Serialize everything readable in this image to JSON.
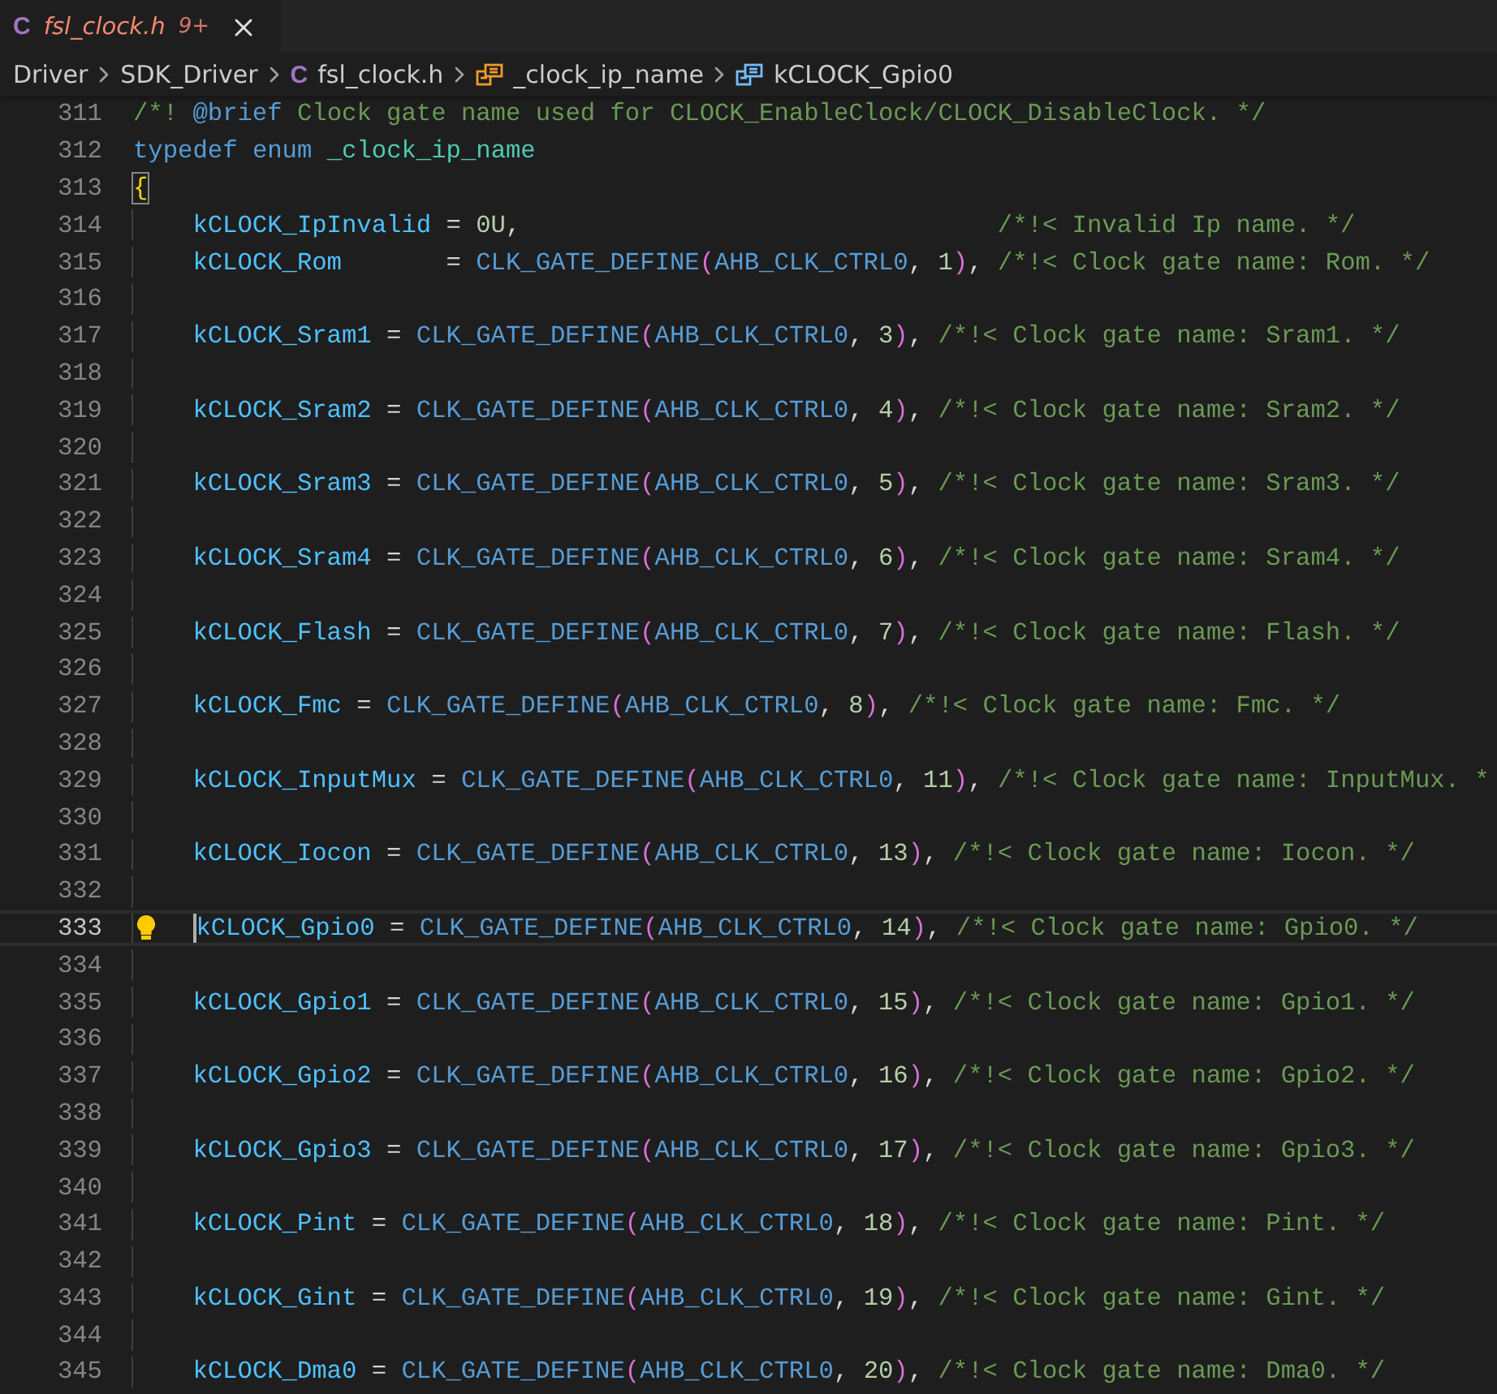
{
  "tab": {
    "icon": "C",
    "label": "fsl_clock.h",
    "badge": "9+"
  },
  "breadcrumb": [
    {
      "kind": "folder",
      "label": "Driver"
    },
    {
      "kind": "folder",
      "label": "SDK_Driver"
    },
    {
      "kind": "file",
      "icon": "C",
      "label": "fsl_clock.h"
    },
    {
      "kind": "enum",
      "label": "_clock_ip_name"
    },
    {
      "kind": "enum-member",
      "label": "kCLOCK_Gpio0"
    }
  ],
  "lines": [
    {
      "number": "311",
      "indented": false,
      "current": false,
      "tokens": [
        {
          "kind": "comment",
          "text": "/*! "
        },
        {
          "kind": "doctag",
          "text": "@brief"
        },
        {
          "kind": "comment",
          "text": " Clock gate name used for CLOCK_EnableClock/CLOCK_DisableClock. */"
        }
      ]
    },
    {
      "number": "312",
      "indented": false,
      "current": false,
      "tokens": [
        {
          "kind": "keyword",
          "text": "typedef"
        },
        {
          "kind": "keyword",
          "text": " enum"
        },
        {
          "kind": "type",
          "text": " _clock_ip_name"
        }
      ]
    },
    {
      "number": "313",
      "indented": false,
      "current": false,
      "tokens": [
        {
          "kind": "bracket",
          "text": "{"
        }
      ]
    },
    {
      "number": "314",
      "indented": true,
      "current": false,
      "tokens": [
        {
          "kind": "member",
          "text": "kCLOCK_IpInvalid"
        },
        {
          "kind": "punct",
          "text": " = "
        },
        {
          "kind": "number",
          "text": "0U"
        },
        {
          "kind": "punct",
          "text": ",                                "
        },
        {
          "kind": "comment",
          "text": "/*!< Invalid Ip name. */"
        }
      ]
    },
    {
      "number": "315",
      "indented": true,
      "current": false,
      "tokens": [
        {
          "kind": "member",
          "text": "kCLOCK_Rom"
        },
        {
          "kind": "punct",
          "text": "       = "
        },
        {
          "kind": "macro",
          "text": "CLK_GATE_DEFINE"
        },
        {
          "kind": "paren",
          "text": "("
        },
        {
          "kind": "macro",
          "text": "AHB_CLK_CTRL0"
        },
        {
          "kind": "punct",
          "text": ", "
        },
        {
          "kind": "number",
          "text": "1"
        },
        {
          "kind": "paren",
          "text": ")"
        },
        {
          "kind": "punct",
          "text": ", "
        },
        {
          "kind": "comment",
          "text": "/*!< Clock gate name: Rom. */"
        }
      ]
    },
    {
      "number": "316",
      "indented": true,
      "current": false
    },
    {
      "number": "317",
      "indented": true,
      "current": false,
      "tokens": [
        {
          "kind": "member",
          "text": "kCLOCK_Sram1"
        },
        {
          "kind": "punct",
          "text": " = "
        },
        {
          "kind": "macro",
          "text": "CLK_GATE_DEFINE"
        },
        {
          "kind": "paren",
          "text": "("
        },
        {
          "kind": "macro",
          "text": "AHB_CLK_CTRL0"
        },
        {
          "kind": "punct",
          "text": ", "
        },
        {
          "kind": "number",
          "text": "3"
        },
        {
          "kind": "paren",
          "text": ")"
        },
        {
          "kind": "punct",
          "text": ", "
        },
        {
          "kind": "comment",
          "text": "/*!< Clock gate name: Sram1. */"
        }
      ]
    },
    {
      "number": "318",
      "indented": true,
      "current": false
    },
    {
      "number": "319",
      "indented": true,
      "current": false,
      "tokens": [
        {
          "kind": "member",
          "text": "kCLOCK_Sram2"
        },
        {
          "kind": "punct",
          "text": " = "
        },
        {
          "kind": "macro",
          "text": "CLK_GATE_DEFINE"
        },
        {
          "kind": "paren",
          "text": "("
        },
        {
          "kind": "macro",
          "text": "AHB_CLK_CTRL0"
        },
        {
          "kind": "punct",
          "text": ", "
        },
        {
          "kind": "number",
          "text": "4"
        },
        {
          "kind": "paren",
          "text": ")"
        },
        {
          "kind": "punct",
          "text": ", "
        },
        {
          "kind": "comment",
          "text": "/*!< Clock gate name: Sram2. */"
        }
      ]
    },
    {
      "number": "320",
      "indented": true,
      "current": false
    },
    {
      "number": "321",
      "indented": true,
      "current": false,
      "tokens": [
        {
          "kind": "member",
          "text": "kCLOCK_Sram3"
        },
        {
          "kind": "punct",
          "text": " = "
        },
        {
          "kind": "macro",
          "text": "CLK_GATE_DEFINE"
        },
        {
          "kind": "paren",
          "text": "("
        },
        {
          "kind": "macro",
          "text": "AHB_CLK_CTRL0"
        },
        {
          "kind": "punct",
          "text": ", "
        },
        {
          "kind": "number",
          "text": "5"
        },
        {
          "kind": "paren",
          "text": ")"
        },
        {
          "kind": "punct",
          "text": ", "
        },
        {
          "kind": "comment",
          "text": "/*!< Clock gate name: Sram3. */"
        }
      ]
    },
    {
      "number": "322",
      "indented": true,
      "current": false
    },
    {
      "number": "323",
      "indented": true,
      "current": false,
      "tokens": [
        {
          "kind": "member",
          "text": "kCLOCK_Sram4"
        },
        {
          "kind": "punct",
          "text": " = "
        },
        {
          "kind": "macro",
          "text": "CLK_GATE_DEFINE"
        },
        {
          "kind": "paren",
          "text": "("
        },
        {
          "kind": "macro",
          "text": "AHB_CLK_CTRL0"
        },
        {
          "kind": "punct",
          "text": ", "
        },
        {
          "kind": "number",
          "text": "6"
        },
        {
          "kind": "paren",
          "text": ")"
        },
        {
          "kind": "punct",
          "text": ", "
        },
        {
          "kind": "comment",
          "text": "/*!< Clock gate name: Sram4. */"
        }
      ]
    },
    {
      "number": "324",
      "indented": true,
      "current": false
    },
    {
      "number": "325",
      "indented": true,
      "current": false,
      "tokens": [
        {
          "kind": "member",
          "text": "kCLOCK_Flash"
        },
        {
          "kind": "punct",
          "text": " = "
        },
        {
          "kind": "macro",
          "text": "CLK_GATE_DEFINE"
        },
        {
          "kind": "paren",
          "text": "("
        },
        {
          "kind": "macro",
          "text": "AHB_CLK_CTRL0"
        },
        {
          "kind": "punct",
          "text": ", "
        },
        {
          "kind": "number",
          "text": "7"
        },
        {
          "kind": "paren",
          "text": ")"
        },
        {
          "kind": "punct",
          "text": ", "
        },
        {
          "kind": "comment",
          "text": "/*!< Clock gate name: Flash. */"
        }
      ]
    },
    {
      "number": "326",
      "indented": true,
      "current": false
    },
    {
      "number": "327",
      "indented": true,
      "current": false,
      "tokens": [
        {
          "kind": "member",
          "text": "kCLOCK_Fmc"
        },
        {
          "kind": "punct",
          "text": " = "
        },
        {
          "kind": "macro",
          "text": "CLK_GATE_DEFINE"
        },
        {
          "kind": "paren",
          "text": "("
        },
        {
          "kind": "macro",
          "text": "AHB_CLK_CTRL0"
        },
        {
          "kind": "punct",
          "text": ", "
        },
        {
          "kind": "number",
          "text": "8"
        },
        {
          "kind": "paren",
          "text": ")"
        },
        {
          "kind": "punct",
          "text": ", "
        },
        {
          "kind": "comment",
          "text": "/*!< Clock gate name: Fmc. */"
        }
      ]
    },
    {
      "number": "328",
      "indented": true,
      "current": false
    },
    {
      "number": "329",
      "indented": true,
      "current": false,
      "tokens": [
        {
          "kind": "member",
          "text": "kCLOCK_InputMux"
        },
        {
          "kind": "punct",
          "text": " = "
        },
        {
          "kind": "macro",
          "text": "CLK_GATE_DEFINE"
        },
        {
          "kind": "paren",
          "text": "("
        },
        {
          "kind": "macro",
          "text": "AHB_CLK_CTRL0"
        },
        {
          "kind": "punct",
          "text": ", "
        },
        {
          "kind": "number",
          "text": "11"
        },
        {
          "kind": "paren",
          "text": ")"
        },
        {
          "kind": "punct",
          "text": ", "
        },
        {
          "kind": "comment",
          "text": "/*!< Clock gate name: InputMux. *"
        }
      ]
    },
    {
      "number": "330",
      "indented": true,
      "current": false
    },
    {
      "number": "331",
      "indented": true,
      "current": false,
      "tokens": [
        {
          "kind": "member",
          "text": "kCLOCK_Iocon"
        },
        {
          "kind": "punct",
          "text": " = "
        },
        {
          "kind": "macro",
          "text": "CLK_GATE_DEFINE"
        },
        {
          "kind": "paren",
          "text": "("
        },
        {
          "kind": "macro",
          "text": "AHB_CLK_CTRL0"
        },
        {
          "kind": "punct",
          "text": ", "
        },
        {
          "kind": "number",
          "text": "13"
        },
        {
          "kind": "paren",
          "text": ")"
        },
        {
          "kind": "punct",
          "text": ", "
        },
        {
          "kind": "comment",
          "text": "/*!< Clock gate name: Iocon. */"
        }
      ]
    },
    {
      "number": "332",
      "indented": true,
      "current": false
    },
    {
      "number": "333",
      "indented": true,
      "current": true,
      "tokens": [
        {
          "kind": "member",
          "text": "kCLOCK_Gpio0"
        },
        {
          "kind": "punct",
          "text": " = "
        },
        {
          "kind": "macro",
          "text": "CLK_GATE_DEFINE"
        },
        {
          "kind": "paren",
          "text": "("
        },
        {
          "kind": "macro",
          "text": "AHB_CLK_CTRL0"
        },
        {
          "kind": "punct",
          "text": ", "
        },
        {
          "kind": "number",
          "text": "14"
        },
        {
          "kind": "paren",
          "text": ")"
        },
        {
          "kind": "punct",
          "text": ", "
        },
        {
          "kind": "comment",
          "text": "/*!< Clock gate name: Gpio0. */"
        }
      ]
    },
    {
      "number": "334",
      "indented": true,
      "current": false
    },
    {
      "number": "335",
      "indented": true,
      "current": false,
      "tokens": [
        {
          "kind": "member",
          "text": "kCLOCK_Gpio1"
        },
        {
          "kind": "punct",
          "text": " = "
        },
        {
          "kind": "macro",
          "text": "CLK_GATE_DEFINE"
        },
        {
          "kind": "paren",
          "text": "("
        },
        {
          "kind": "macro",
          "text": "AHB_CLK_CTRL0"
        },
        {
          "kind": "punct",
          "text": ", "
        },
        {
          "kind": "number",
          "text": "15"
        },
        {
          "kind": "paren",
          "text": ")"
        },
        {
          "kind": "punct",
          "text": ", "
        },
        {
          "kind": "comment",
          "text": "/*!< Clock gate name: Gpio1. */"
        }
      ]
    },
    {
      "number": "336",
      "indented": true,
      "current": false
    },
    {
      "number": "337",
      "indented": true,
      "current": false,
      "tokens": [
        {
          "kind": "member",
          "text": "kCLOCK_Gpio2"
        },
        {
          "kind": "punct",
          "text": " = "
        },
        {
          "kind": "macro",
          "text": "CLK_GATE_DEFINE"
        },
        {
          "kind": "paren",
          "text": "("
        },
        {
          "kind": "macro",
          "text": "AHB_CLK_CTRL0"
        },
        {
          "kind": "punct",
          "text": ", "
        },
        {
          "kind": "number",
          "text": "16"
        },
        {
          "kind": "paren",
          "text": ")"
        },
        {
          "kind": "punct",
          "text": ", "
        },
        {
          "kind": "comment",
          "text": "/*!< Clock gate name: Gpio2. */"
        }
      ]
    },
    {
      "number": "338",
      "indented": true,
      "current": false
    },
    {
      "number": "339",
      "indented": true,
      "current": false,
      "tokens": [
        {
          "kind": "member",
          "text": "kCLOCK_Gpio3"
        },
        {
          "kind": "punct",
          "text": " = "
        },
        {
          "kind": "macro",
          "text": "CLK_GATE_DEFINE"
        },
        {
          "kind": "paren",
          "text": "("
        },
        {
          "kind": "macro",
          "text": "AHB_CLK_CTRL0"
        },
        {
          "kind": "punct",
          "text": ", "
        },
        {
          "kind": "number",
          "text": "17"
        },
        {
          "kind": "paren",
          "text": ")"
        },
        {
          "kind": "punct",
          "text": ", "
        },
        {
          "kind": "comment",
          "text": "/*!< Clock gate name: Gpio3. */"
        }
      ]
    },
    {
      "number": "340",
      "indented": true,
      "current": false
    },
    {
      "number": "341",
      "indented": true,
      "current": false,
      "tokens": [
        {
          "kind": "member",
          "text": "kCLOCK_Pint"
        },
        {
          "kind": "punct",
          "text": " = "
        },
        {
          "kind": "macro",
          "text": "CLK_GATE_DEFINE"
        },
        {
          "kind": "paren",
          "text": "("
        },
        {
          "kind": "macro",
          "text": "AHB_CLK_CTRL0"
        },
        {
          "kind": "punct",
          "text": ", "
        },
        {
          "kind": "number",
          "text": "18"
        },
        {
          "kind": "paren",
          "text": ")"
        },
        {
          "kind": "punct",
          "text": ", "
        },
        {
          "kind": "comment",
          "text": "/*!< Clock gate name: Pint. */"
        }
      ]
    },
    {
      "number": "342",
      "indented": true,
      "current": false
    },
    {
      "number": "343",
      "indented": true,
      "current": false,
      "tokens": [
        {
          "kind": "member",
          "text": "kCLOCK_Gint"
        },
        {
          "kind": "punct",
          "text": " = "
        },
        {
          "kind": "macro",
          "text": "CLK_GATE_DEFINE"
        },
        {
          "kind": "paren",
          "text": "("
        },
        {
          "kind": "macro",
          "text": "AHB_CLK_CTRL0"
        },
        {
          "kind": "punct",
          "text": ", "
        },
        {
          "kind": "number",
          "text": "19"
        },
        {
          "kind": "paren",
          "text": ")"
        },
        {
          "kind": "punct",
          "text": ", "
        },
        {
          "kind": "comment",
          "text": "/*!< Clock gate name: Gint. */"
        }
      ]
    },
    {
      "number": "344",
      "indented": true,
      "current": false
    },
    {
      "number": "345",
      "indented": true,
      "current": false,
      "tokens": [
        {
          "kind": "member",
          "text": "kCLOCK_Dma0"
        },
        {
          "kind": "punct",
          "text": " = "
        },
        {
          "kind": "macro",
          "text": "CLK_GATE_DEFINE"
        },
        {
          "kind": "paren",
          "text": "("
        },
        {
          "kind": "macro",
          "text": "AHB_CLK_CTRL0"
        },
        {
          "kind": "punct",
          "text": ", "
        },
        {
          "kind": "number",
          "text": "20"
        },
        {
          "kind": "paren",
          "text": ")"
        },
        {
          "kind": "punct",
          "text": ", "
        },
        {
          "kind": "comment",
          "text": "/*!< Clock gate name: Dma0. */"
        }
      ]
    }
  ]
}
